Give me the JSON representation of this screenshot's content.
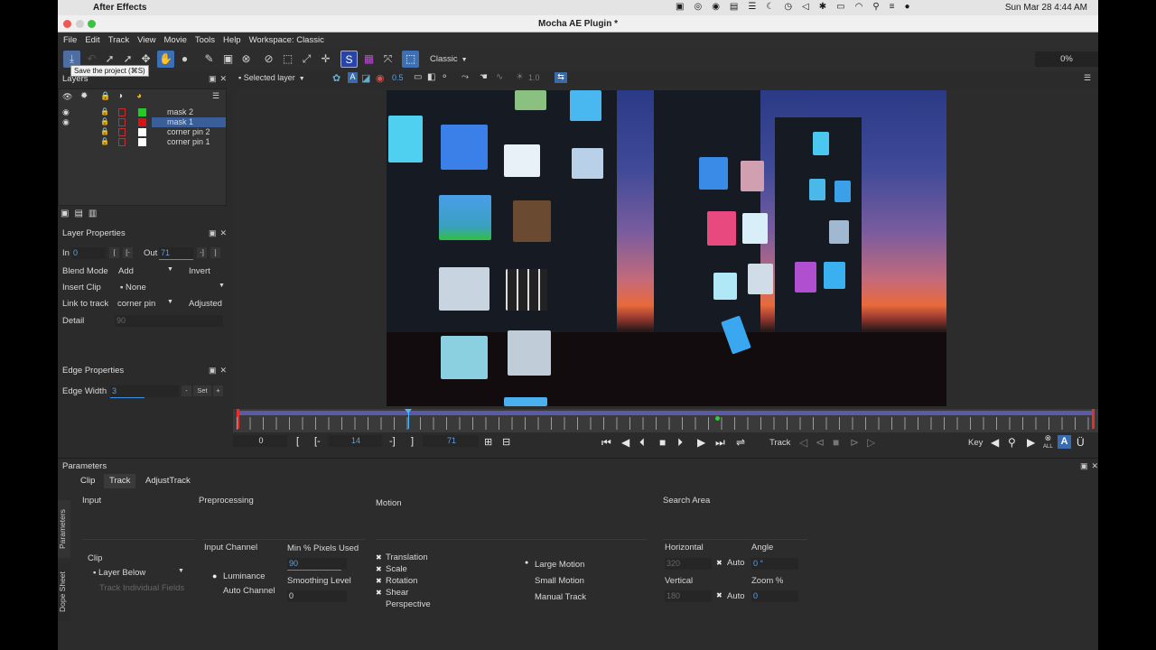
{
  "os_menubar": {
    "app_name": "After Effects",
    "clock": "Sun Mar 28  4:44 AM"
  },
  "window": {
    "title": "Mocha AE Plugin *"
  },
  "menu": [
    "File",
    "Edit",
    "Track",
    "View",
    "Movie",
    "Tools",
    "Help",
    "Workspace: Classic"
  ],
  "toolbar": {
    "tooltip": "Save the project (⌘S)",
    "workspace_dropdown": "Classic",
    "progress": "0%"
  },
  "viewer_toolbar": {
    "selected_layer": "Selected layer",
    "opacity_value": "0.5",
    "zoom_value": "1.0"
  },
  "layers_panel": {
    "title": "Layers",
    "rows": [
      {
        "name": "mask 2",
        "color": "#22cc22",
        "visible": true,
        "selected": false
      },
      {
        "name": "mask 1",
        "color": "#dd1111",
        "visible": true,
        "selected": true
      },
      {
        "name": "corner pin 2",
        "color": "#ffffff",
        "visible": false,
        "selected": false
      },
      {
        "name": "corner pin 1",
        "color": "#ffffff",
        "visible": false,
        "selected": false
      }
    ]
  },
  "layer_properties": {
    "title": "Layer Properties",
    "in_label": "In",
    "in_value": "0",
    "out_label": "Out",
    "out_value": "71",
    "blend_mode_label": "Blend Mode",
    "blend_mode_value": "Add",
    "invert_label": "Invert",
    "insert_clip_label": "Insert Clip",
    "insert_clip_value": "None",
    "link_to_track_label": "Link to track",
    "link_to_track_value": "corner pin",
    "adjusted_label": "Adjusted",
    "detail_label": "Detail",
    "detail_value": "90"
  },
  "edge_properties": {
    "title": "Edge Properties",
    "edge_width_label": "Edge Width",
    "edge_width_value": "3",
    "set_label": "Set"
  },
  "timeline": {
    "frame_start": "0",
    "in_point": "14",
    "out_point": "71",
    "playhead_fraction": 0.2,
    "keyframe_fraction": 0.56,
    "track_label": "Track",
    "key_label": "Key",
    "all_label": "ALL"
  },
  "parameters": {
    "title": "Parameters",
    "tabs": [
      "Clip",
      "Track",
      "AdjustTrack"
    ],
    "side_tabs": [
      "Parameters",
      "Dope Sheet"
    ],
    "input": {
      "title": "Input",
      "clip_label": "Clip",
      "clip_value": "Layer Below",
      "track_individual_fields": "Track Individual Fields"
    },
    "preprocessing": {
      "title": "Preprocessing",
      "input_channel_label": "Input Channel",
      "luminance": "Luminance",
      "auto_channel": "Auto Channel",
      "min_pixels_label": "Min % Pixels Used",
      "min_pixels_value": "90",
      "smoothing_label": "Smoothing Level",
      "smoothing_value": "0"
    },
    "motion": {
      "title": "Motion",
      "options": [
        {
          "label": "Translation",
          "checked": true
        },
        {
          "label": "Scale",
          "checked": true
        },
        {
          "label": "Rotation",
          "checked": true
        },
        {
          "label": "Shear",
          "checked": true
        },
        {
          "label": "Perspective",
          "checked": false
        }
      ],
      "large_motion": "Large Motion",
      "small_motion": "Small Motion",
      "manual_track": "Manual Track"
    },
    "search_area": {
      "title": "Search Area",
      "horizontal_label": "Horizontal",
      "horizontal_value": "320",
      "vertical_label": "Vertical",
      "vertical_value": "180",
      "auto_label": "Auto",
      "angle_label": "Angle",
      "angle_value": "0 °",
      "zoom_label": "Zoom %",
      "zoom_value": "0"
    }
  }
}
